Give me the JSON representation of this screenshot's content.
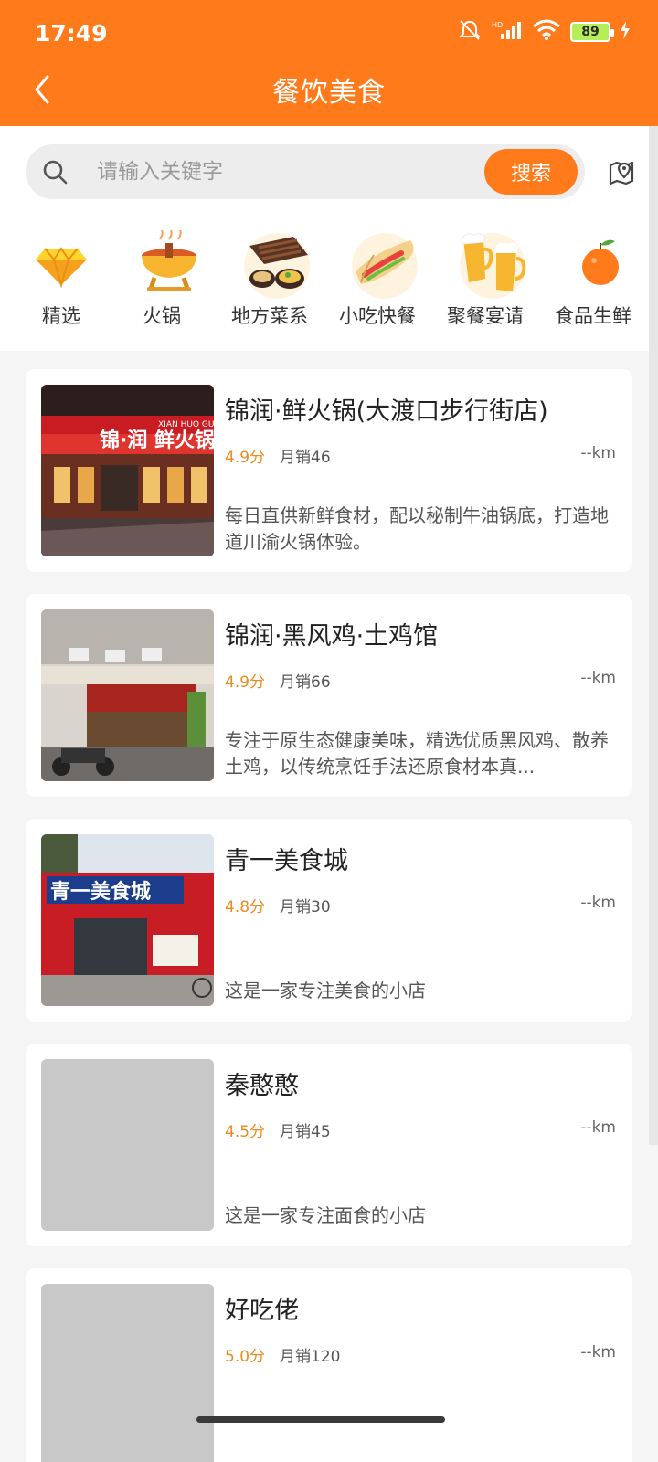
{
  "status_bar": {
    "time": "17:49",
    "battery": "89",
    "icons": [
      "mute-icon",
      "hd-signal-icon",
      "wifi-icon",
      "battery-icon",
      "charging-icon"
    ]
  },
  "header": {
    "title": "餐饮美食",
    "back_icon": "chevron-left-icon"
  },
  "search": {
    "placeholder": "请输入关键字",
    "value": "",
    "button_label": "搜索",
    "map_icon": "map-pin-icon"
  },
  "categories": [
    {
      "label": "精选",
      "icon": "diamond-icon"
    },
    {
      "label": "火锅",
      "icon": "hotpot-icon"
    },
    {
      "label": "地方菜系",
      "icon": "local-cuisine-icon"
    },
    {
      "label": "小吃快餐",
      "icon": "wrap-snack-icon"
    },
    {
      "label": "聚餐宴请",
      "icon": "beer-cheers-icon"
    },
    {
      "label": "食品生鲜",
      "icon": "orange-fruit-icon"
    }
  ],
  "stores": [
    {
      "name": "锦润·鲜火锅(大渡口步行街店)",
      "rating": "4.9分",
      "sales": "月销46",
      "distance": "--km",
      "description": "每日直供新鲜食材，配以秘制牛油锅底，打造地道川渝火锅体验。"
    },
    {
      "name": "锦润·黑风鸡·土鸡馆",
      "rating": "4.9分",
      "sales": "月销66",
      "distance": "--km",
      "description": "专注于原生态健康美味，精选优质黑风鸡、散养土鸡，以传统烹饪手法还原食材本真..."
    },
    {
      "name": "青一美食城",
      "rating": "4.8分",
      "sales": "月销30",
      "distance": "--km",
      "description": "这是一家专注美食的小店"
    },
    {
      "name": "秦憨憨",
      "rating": "4.5分",
      "sales": "月销45",
      "distance": "--km",
      "description": "这是一家专注面食的小店"
    },
    {
      "name": "好吃佬",
      "rating": "5.0分",
      "sales": "月销120",
      "distance": "--km",
      "description": ""
    }
  ],
  "storefront_signs": {
    "jinrun_hotpot": "锦·润 鲜火锅",
    "jinrun_hotpot_pinyin": "XIAN HUO GUO",
    "qingyi": "青一美食城"
  },
  "colors": {
    "brand": "#ff7a1a",
    "rating": "#f08a1c",
    "page_background": "#f5f5f5"
  }
}
